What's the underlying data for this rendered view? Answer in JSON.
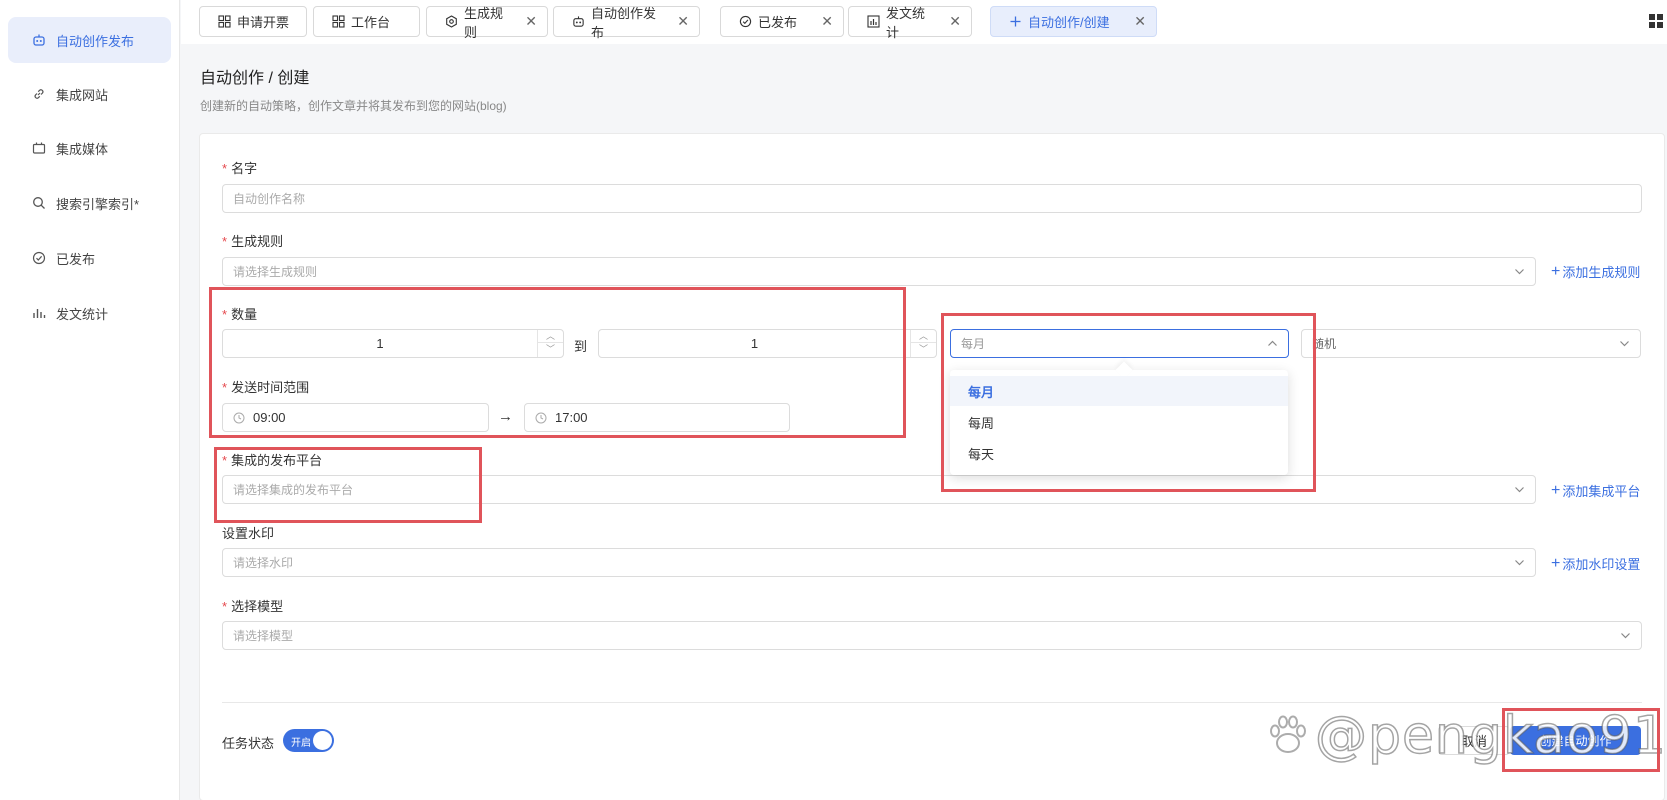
{
  "sidebar": {
    "items": [
      {
        "label": "自动创作发布",
        "icon": "robot-icon",
        "active": true
      },
      {
        "label": "集成网站",
        "icon": "link-icon",
        "active": false
      },
      {
        "label": "集成媒体",
        "icon": "media-icon",
        "active": false
      },
      {
        "label": "搜索引擎索引*",
        "icon": "search-icon",
        "active": false
      },
      {
        "label": "已发布",
        "icon": "check-circle-icon",
        "active": false
      },
      {
        "label": "发文统计",
        "icon": "bar-chart-icon",
        "active": false
      }
    ]
  },
  "tabs": [
    {
      "label": "申请开票",
      "icon": "grid-icon",
      "closable": false
    },
    {
      "label": "工作台",
      "icon": "grid-icon",
      "closable": false
    },
    {
      "label": "生成规则",
      "icon": "gear-icon",
      "closable": true
    },
    {
      "label": "自动创作发布",
      "icon": "robot-icon",
      "closable": true
    },
    {
      "label": "已发布",
      "icon": "check-circle-icon",
      "closable": true
    },
    {
      "label": "发文统计",
      "icon": "bar-chart-icon",
      "closable": true
    },
    {
      "label": "自动创作/创建",
      "icon": "plus-icon",
      "closable": true,
      "active": true
    }
  ],
  "tab_close_glyph": "✕",
  "header": {
    "title": "自动创作 / 创建",
    "subtitle": "创建新的自动策略，创作文章并将其发布到您的网站(blog)"
  },
  "form": {
    "required_mark": "*",
    "name": {
      "label": "名字",
      "placeholder": "自动创作名称"
    },
    "rule": {
      "label": "生成规则",
      "placeholder": "请选择生成规则",
      "add_link": "添加生成规则"
    },
    "quantity": {
      "label": "数量",
      "min_value": "1",
      "to_text": "到",
      "max_value": "1",
      "period": {
        "value": "每月",
        "options": [
          "每月",
          "每周",
          "每天"
        ],
        "selected": "每月"
      },
      "mode": {
        "value": "随机"
      }
    },
    "send_time": {
      "label": "发送时间范围",
      "start": "09:00",
      "arrow": "→",
      "end": "17:00"
    },
    "platform": {
      "label": "集成的发布平台",
      "placeholder": "请选择集成的发布平台",
      "add_link": "添加集成平台"
    },
    "watermark": {
      "label": "设置水印",
      "placeholder": "请选择水印",
      "add_link": "添加水印设置"
    },
    "model": {
      "label": "选择模型",
      "placeholder": "请选择模型"
    },
    "task_status": {
      "label": "任务状态",
      "toggle_label": "开启",
      "on": true
    },
    "cancel_button": "取消",
    "submit_button": "创建自动创作"
  },
  "watermark_overlay": {
    "text": "@pengkao910"
  },
  "colors": {
    "accent": "#3b6fe0",
    "highlight": "#e0545a",
    "required": "#e5484d"
  }
}
